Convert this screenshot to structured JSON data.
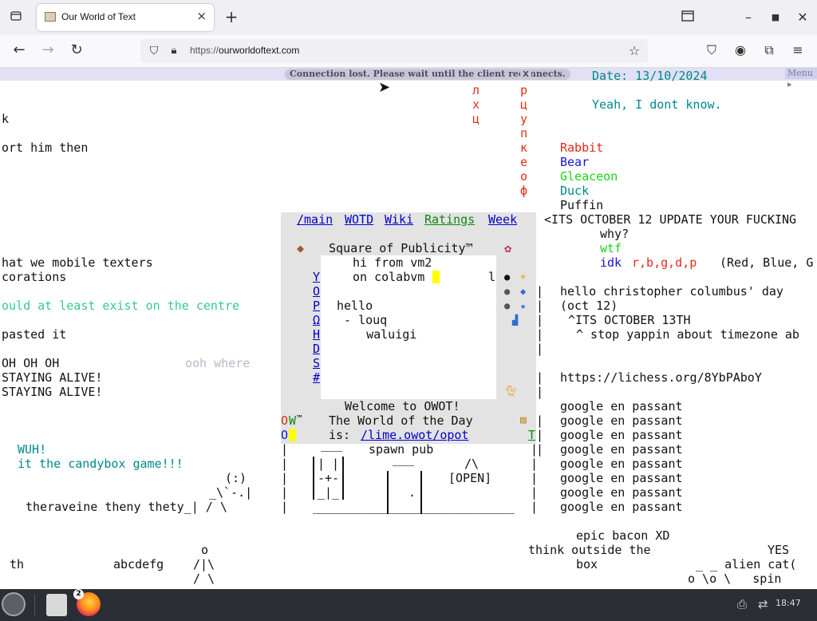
{
  "browser": {
    "tab_title": "Our World of Text",
    "url_prefix": "https://",
    "url_host": "ourworldoftext.com"
  },
  "status": {
    "connection": "Connection lost. Please wait until the client reconnects.",
    "close": "X",
    "menu": "Menu ▸"
  },
  "left": {
    "l1": "k",
    "l2": "ort him then",
    "l3": "hat we mobile texters",
    "l4": "corations",
    "l5": "ould at least exist on the centre",
    "l6": "pasted it",
    "l7": "OH OH OH",
    "l7b": "ooh where",
    "l8": "STAYING ALIVE!",
    "l9": "STAYING ALIVE!",
    "wuh": "WUH!",
    "candy": "it the candybox game!!!",
    "art1": "(:)",
    "art2": "_\\`-.|",
    "art3": "theraveine theny thety_| / \\",
    "th": "th",
    "abc": "abcdefg",
    "fig1": "o",
    "fig2": "/|\\",
    "fig3": "/ \\"
  },
  "cyr": {
    "c1": [
      "л",
      "х",
      "ц"
    ],
    "c2": [
      "р",
      "ц",
      "у",
      "п",
      "к",
      "е",
      "о",
      "ф"
    ]
  },
  "right": {
    "date": "Date: 13/10/2024",
    "dont_know": "Yeah, I dont know.",
    "animals": [
      "Rabbit",
      "Bear",
      "Gleaceon",
      "Duck",
      "Puffin"
    ],
    "october": "<ITS OCTOBER 12 UPDATE YOUR FUCKING",
    "why": "why?",
    "wtf": "wtf",
    "idk": "idk",
    "rbgdp": "r,b,g,d,p",
    "rbgdp_tail": "(Red, Blue, G",
    "columbus": "hello christopher columbus' day",
    "oct12": "(oct 12)",
    "oct13": "^ITS OCTOBER 13TH",
    "yappin": "^ stop yappin about timezone ab",
    "lichess": "https://lichess.org/8YbPAboY",
    "google": [
      "google en passant",
      "google en passant",
      "google en passant",
      "google en passant",
      "google en passant",
      "google en passant",
      "google en passant",
      "google en passant"
    ],
    "bacon": "epic bacon XD",
    "think": "think outside the",
    "box": "box",
    "yes": "YES",
    "alien": "_ _ alien cat(",
    "spin": "o \\o \\   spin",
    "pipes": [
      "|",
      "|",
      "|",
      "|",
      "|",
      "|",
      "|",
      "|",
      "|",
      "|"
    ]
  },
  "panel": {
    "links": [
      "/main",
      "WOTD",
      "Wiki",
      "Ratings",
      "Week"
    ],
    "square": "Square of Publicity™",
    "side_letters": [
      "Y",
      "O",
      "P",
      "Ω",
      "H",
      "D",
      "S",
      "#"
    ],
    "inner_lines": [
      "hi from vm2",
      "on colabvm",
      "hello",
      " - louq",
      "   waluigi"
    ],
    "inner_l": "l",
    "welcome1": "Welcome to OWOT!",
    "welcome2": "The World of the Day",
    "welcome_is": "is:",
    "welcome_link": "/lime.owot/opot",
    "ow_o": "O",
    "ow_w": "W",
    "ow_tm": "™",
    "o2": "O",
    "t_link": "T"
  },
  "pub": {
    "spawn": "spawn pub",
    "open_roof": "/\\",
    "open": "[OPEN]",
    "win1": "| |",
    "win2": "-+-",
    "win3": "_|_",
    "door_top": "___",
    "door_dot": ".",
    "bracket": "|",
    "underline": "____________________________"
  },
  "taskbar": {
    "badge": "2",
    "clock": "18:47"
  },
  "colors": {
    "teal": "#00898a",
    "red": "#e52a14",
    "blue": "#1414d6",
    "green": "#18d418",
    "light_green": "#33cc88",
    "gray": "#b8b8cc",
    "panel_green": "#0d8a0d"
  }
}
